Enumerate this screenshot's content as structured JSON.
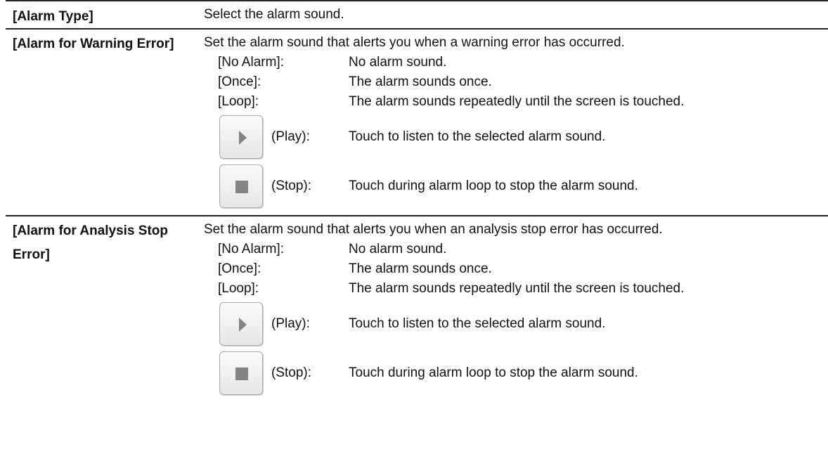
{
  "rows": [
    {
      "term": "[Alarm Type]",
      "description": "Select the alarm sound."
    },
    {
      "term": "[Alarm for Warning Error]",
      "description": "Set the alarm sound that alerts you when a warning error has occurred.",
      "options": [
        {
          "label": "[No Alarm]:",
          "text": "No alarm sound."
        },
        {
          "label": "[Once]:",
          "text": "The alarm sounds once."
        },
        {
          "label": "[Loop]:",
          "text": "The alarm sounds repeatedly until the screen is touched."
        }
      ],
      "buttons": [
        {
          "icon": "play-icon",
          "label": "(Play):",
          "text": "Touch to listen to the selected alarm sound."
        },
        {
          "icon": "stop-icon",
          "label": "(Stop):",
          "text": "Touch during alarm loop to stop the alarm sound."
        }
      ]
    },
    {
      "term": "[Alarm for Analysis Stop Error]",
      "description": "Set the alarm sound that alerts you when an analysis stop error has occurred.",
      "options": [
        {
          "label": "[No Alarm]:",
          "text": "No alarm sound."
        },
        {
          "label": "[Once]:",
          "text": "The alarm sounds once."
        },
        {
          "label": "[Loop]:",
          "text": "The alarm sounds repeatedly until the screen is touched."
        }
      ],
      "buttons": [
        {
          "icon": "play-icon",
          "label": "(Play):",
          "text": "Touch to listen to the selected alarm sound."
        },
        {
          "icon": "stop-icon",
          "label": "(Stop):",
          "text": "Touch during alarm loop to stop the alarm sound."
        }
      ]
    }
  ]
}
